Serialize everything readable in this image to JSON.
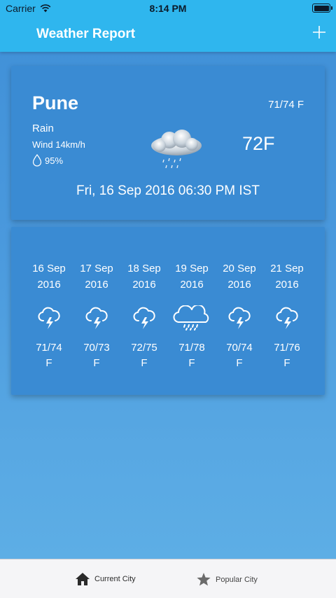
{
  "status": {
    "carrier": "Carrier",
    "time": "8:14 PM"
  },
  "nav": {
    "title": "Weather Report",
    "add_icon": "plus-icon"
  },
  "current": {
    "city": "Pune",
    "range": "71/74 F",
    "condition": "Rain",
    "wind": "Wind 14km/h",
    "humidity": "95%",
    "temp": "72F",
    "datetime": "Fri, 16 Sep 2016 06:30 PM IST",
    "icon": "rain-cloud-icon"
  },
  "forecast": [
    {
      "day": "16 Sep",
      "year": "2016",
      "icon": "thunderstorm-icon",
      "range": "71/74",
      "unit": "F"
    },
    {
      "day": "17 Sep",
      "year": "2016",
      "icon": "thunderstorm-icon",
      "range": "70/73",
      "unit": "F"
    },
    {
      "day": "18 Sep",
      "year": "2016",
      "icon": "thunderstorm-icon",
      "range": "72/75",
      "unit": "F"
    },
    {
      "day": "19 Sep",
      "year": "2016",
      "icon": "rain-cloud-icon",
      "range": "71/78",
      "unit": "F"
    },
    {
      "day": "20 Sep",
      "year": "2016",
      "icon": "thunderstorm-icon",
      "range": "70/74",
      "unit": "F"
    },
    {
      "day": "21 Sep",
      "year": "2016",
      "icon": "thunderstorm-icon",
      "range": "71/76",
      "unit": "F"
    }
  ],
  "tabs": [
    {
      "label": "Current City",
      "icon": "home-icon"
    },
    {
      "label": "Popular City",
      "icon": "star-icon"
    }
  ],
  "colors": {
    "header": "#2fb6ee",
    "card": "#3a8bd3",
    "background_top": "#3f8fd7",
    "background_bottom": "#5fb0e6"
  }
}
